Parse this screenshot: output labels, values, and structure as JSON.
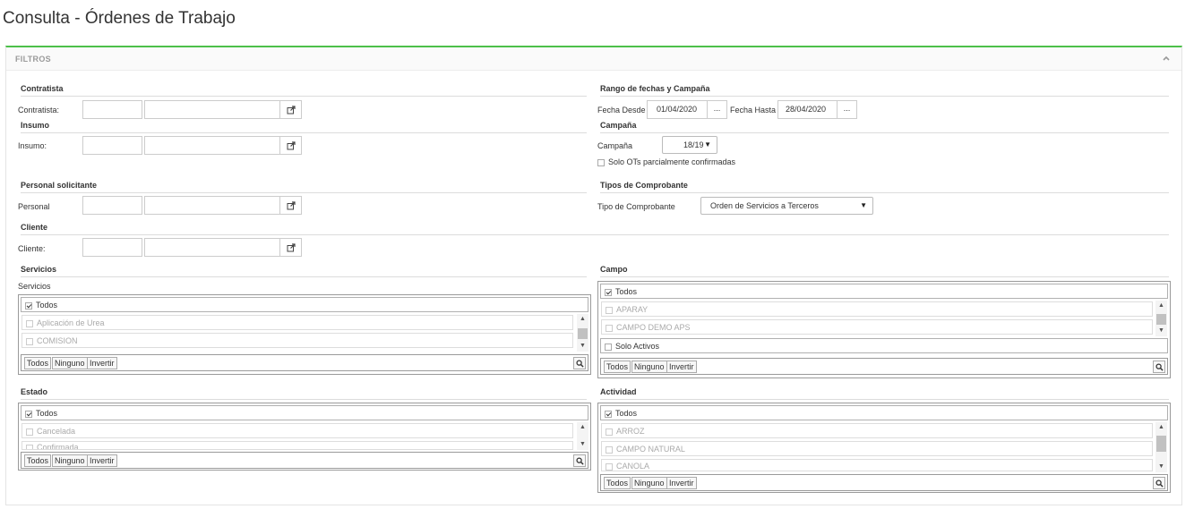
{
  "page": {
    "title": "Consulta - Órdenes de Trabajo"
  },
  "filters": {
    "header": "FILTROS",
    "contratista": {
      "section": "Contratista",
      "label": "Contratista:",
      "code": "",
      "name": ""
    },
    "insumo": {
      "section": "Insumo",
      "label": "Insumo:",
      "code": "",
      "name": ""
    },
    "personal": {
      "section": "Personal solicitante",
      "label": "Personal",
      "code": "",
      "name": ""
    },
    "cliente": {
      "section": "Cliente",
      "label": "Cliente:",
      "code": "",
      "name": ""
    },
    "rango": {
      "section": "Rango de fechas y Campaña",
      "desde_label": "Fecha Desde",
      "desde_value": "01/04/2020",
      "hasta_label": "Fecha Hasta",
      "hasta_value": "28/04/2020",
      "dots": "..."
    },
    "campania": {
      "section": "Campaña",
      "label": "Campaña",
      "value": "18/19",
      "solo_label": "Solo OTs parcialmente confirmadas"
    },
    "tipos": {
      "section": "Tipos de Comprobante",
      "label": "Tipo de Comprobante",
      "value": "Orden de Servicios a Terceros"
    },
    "servicios": {
      "section": "Servicios",
      "label": "Servicios",
      "all": "Todos",
      "items": [
        "Aplicación de Urea",
        "COMISION"
      ]
    },
    "campo": {
      "section": "Campo",
      "all": "Todos",
      "items": [
        "APARAY",
        "CAMPO DEMO APS"
      ],
      "solo_activos": "Solo Activos"
    },
    "estado": {
      "section": "Estado",
      "all": "Todos",
      "items": [
        "Cancelada",
        "Confirmada"
      ]
    },
    "actividad": {
      "section": "Actividad",
      "all": "Todos",
      "items": [
        "ARROZ",
        "CAMPO NATURAL",
        "CANOLA"
      ]
    },
    "toolbar": {
      "todos": "Todos",
      "ninguno": "Ninguno",
      "invertir": "Invertir"
    }
  }
}
